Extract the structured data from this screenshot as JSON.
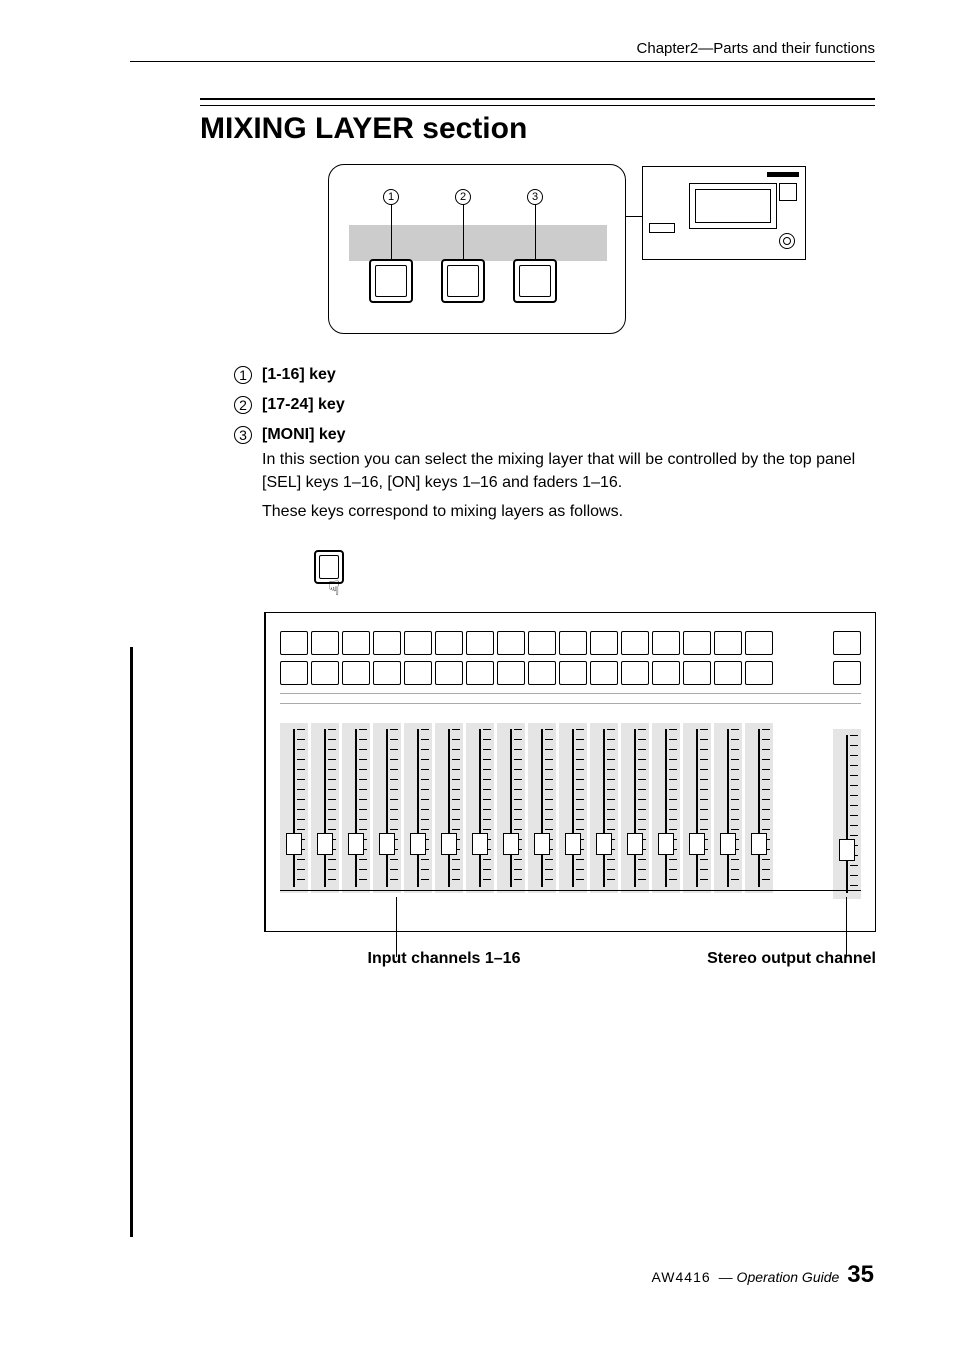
{
  "header": "Chapter2—Parts and their functions",
  "title": "MIXING LAYER section",
  "callouts": [
    "1",
    "2",
    "3"
  ],
  "items": [
    {
      "num": "1",
      "label": "[1-16] key"
    },
    {
      "num": "2",
      "label": "[17-24] key"
    },
    {
      "num": "3",
      "label": "[MONI] key"
    }
  ],
  "body": {
    "p1": "In this section you can select the mixing layer that will be controlled by the top panel [SEL] keys 1–16, [ON] keys 1–16 and faders 1–16.",
    "p2": "These keys correspond to mixing layers as follows."
  },
  "captions": {
    "left": "Input channels 1–16",
    "right": "Stereo output channel"
  },
  "footer": {
    "brand": "AW4416",
    "guide": "— Operation Guide",
    "page": "35"
  },
  "channel_count": 16
}
